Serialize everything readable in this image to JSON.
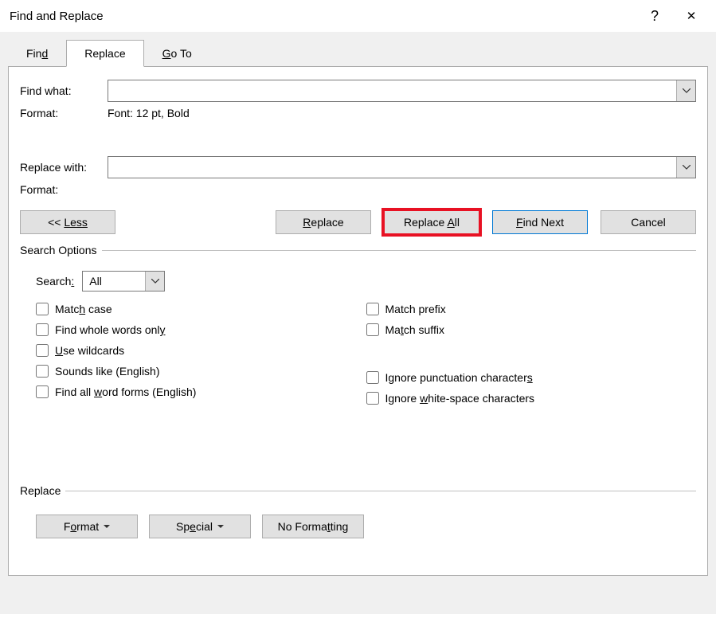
{
  "title": "Find and Replace",
  "help_glyph": "?",
  "close_glyph": "✕",
  "tabs": {
    "find": "Find",
    "replace": "Replace",
    "goto": "Go To"
  },
  "labels": {
    "find_what": "Find what:",
    "format": "Format:",
    "replace_with": "Replace with:",
    "format_value": "Font: 12 pt, Bold",
    "search_options_legend": "Search Options",
    "search": "Search:",
    "replace_legend": "Replace"
  },
  "buttons": {
    "less_pre": "<<",
    "less": "Less",
    "replace": "Replace",
    "replace_all_pre": "Replace ",
    "replace_all_u": "A",
    "replace_all_post": "ll",
    "find_next_u": "F",
    "find_next_post": "ind Next",
    "cancel": "Cancel",
    "format_btn_pre": "F",
    "format_btn_u": "o",
    "format_btn_post": "rmat",
    "special_pre": "Sp",
    "special_u": "e",
    "special_post": "cial",
    "no_formatting_pre": "No Forma",
    "no_formatting_u": "t",
    "no_formatting_post": "ting"
  },
  "search_dd": {
    "value": "All"
  },
  "checkboxes": {
    "match_case_pre": "Matc",
    "match_case_u": "h",
    "match_case_post": " case",
    "whole_words_pre": "Find whole words onl",
    "whole_words_u": "y",
    "wildcards_u": "U",
    "wildcards_post": "se wildcards",
    "sounds_like": "Sounds like (English)",
    "word_forms_pre": "Find all ",
    "word_forms_u": "w",
    "word_forms_post": "ord forms (English)",
    "match_prefix": "Match prefix",
    "match_suffix_pre": "Ma",
    "match_suffix_u": "t",
    "match_suffix_post": "ch suffix",
    "ignore_punct_pre": "Ignore punctuation character",
    "ignore_punct_u": "s",
    "ignore_ws_pre": "Ignore ",
    "ignore_ws_u": "w",
    "ignore_ws_post": "hite-space characters"
  }
}
